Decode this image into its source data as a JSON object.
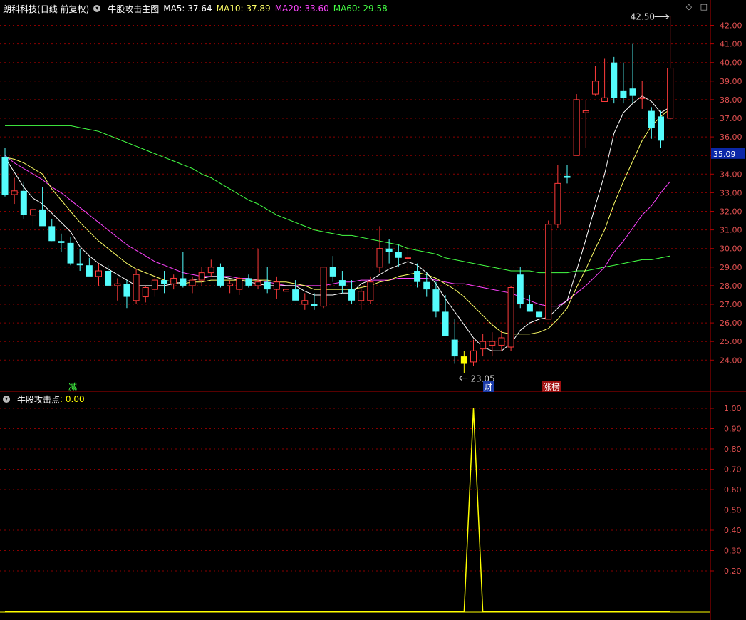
{
  "main_panel": {
    "stock_name": "朗科科技",
    "period_label": "(日线 前复权)",
    "indicator_name": "牛股攻击主图",
    "ma_legend": [
      {
        "label": "MA5: 37.64",
        "color": "#ffffff"
      },
      {
        "label": "MA10: 37.89",
        "color": "#ffff66"
      },
      {
        "label": "MA20: 33.60",
        "color": "#ff44ff"
      },
      {
        "label": "MA60: 29.58",
        "color": "#44ff44"
      }
    ]
  },
  "sub_panel": {
    "indicator_name": "牛股攻击点",
    "value_label": ": 0.00"
  },
  "markers": {
    "jian": "减",
    "cai": "财",
    "zhangbang": "涨榜",
    "high": "42.50",
    "low": "23.05",
    "current_price": "35.09"
  },
  "colors": {
    "up": "#ff3b3b",
    "down": "#54fcfc",
    "grid": "#8b0000",
    "axis": "#b00000",
    "signal": "#ffff00",
    "price_tag_bg": "#0b27a8"
  },
  "chart_data": {
    "type": "candlestick",
    "main_y_ticks": [
      24.0,
      25.0,
      26.0,
      27.0,
      28.0,
      29.0,
      30.0,
      31.0,
      32.0,
      33.0,
      34.0,
      35.0,
      36.0,
      37.0,
      38.0,
      39.0,
      40.0,
      41.0,
      42.0
    ],
    "main_y_tick_labels": [
      "24.00",
      "25.00",
      "26.00",
      "27.00",
      "28.00",
      "29.00",
      "30.00",
      "31.00",
      "32.00",
      "33.00",
      "34.00",
      "35.00",
      "36.00",
      "37.00",
      "38.00",
      "39.00",
      "40.00",
      "41.00",
      "42.00"
    ],
    "sub_y_ticks": [
      0.2,
      0.3,
      0.4,
      0.5,
      0.6,
      0.7,
      0.8,
      0.9,
      1.0
    ],
    "sub_y_tick_labels": [
      "0.20",
      "0.30",
      "0.40",
      "0.50",
      "0.60",
      "0.70",
      "0.80",
      "0.90",
      "1.00"
    ],
    "candles": [
      [
        34.9,
        35.4,
        32.8,
        32.9
      ],
      [
        32.9,
        33.8,
        32.4,
        33.1
      ],
      [
        33.1,
        33.6,
        31.6,
        31.8
      ],
      [
        31.8,
        32.2,
        31.2,
        32.1
      ],
      [
        32.1,
        33.3,
        31.3,
        31.2
      ],
      [
        31.2,
        31.6,
        30.4,
        30.4
      ],
      [
        30.4,
        30.8,
        29.8,
        30.3
      ],
      [
        30.3,
        30.6,
        29.1,
        29.2
      ],
      [
        29.2,
        30.0,
        28.8,
        29.1
      ],
      [
        29.1,
        29.5,
        28.6,
        28.5
      ],
      [
        28.5,
        29.2,
        28.0,
        28.8
      ],
      [
        28.8,
        29.1,
        28.1,
        28.0
      ],
      [
        28.0,
        28.4,
        27.2,
        28.1
      ],
      [
        28.1,
        28.3,
        26.8,
        27.4
      ],
      [
        27.2,
        28.9,
        27.0,
        28.6
      ],
      [
        27.4,
        28.0,
        27.1,
        27.9
      ],
      [
        27.8,
        28.6,
        27.4,
        28.3
      ],
      [
        28.3,
        28.8,
        27.6,
        28.1
      ],
      [
        28.1,
        28.6,
        27.8,
        28.4
      ],
      [
        28.4,
        29.8,
        27.9,
        28.0
      ],
      [
        28.0,
        28.5,
        27.6,
        28.3
      ],
      [
        28.3,
        29.0,
        28.0,
        28.7
      ],
      [
        28.7,
        29.4,
        28.5,
        29.0
      ],
      [
        29.0,
        29.2,
        27.9,
        28.0
      ],
      [
        28.0,
        28.3,
        27.6,
        28.1
      ],
      [
        27.8,
        28.5,
        27.5,
        28.4
      ],
      [
        28.4,
        28.6,
        27.9,
        28.0
      ],
      [
        28.0,
        30.0,
        27.8,
        28.2
      ],
      [
        28.2,
        29.0,
        27.6,
        27.8
      ],
      [
        27.8,
        28.5,
        27.3,
        28.2
      ],
      [
        27.7,
        28.0,
        27.1,
        27.8
      ],
      [
        27.8,
        28.3,
        27.3,
        27.2
      ],
      [
        27.0,
        27.6,
        26.7,
        27.2
      ],
      [
        27.0,
        27.6,
        26.7,
        26.9
      ],
      [
        26.9,
        29.0,
        26.8,
        29.0
      ],
      [
        29.0,
        29.6,
        28.2,
        28.5
      ],
      [
        28.3,
        28.8,
        27.6,
        28.0
      ],
      [
        27.8,
        28.3,
        27.0,
        27.2
      ],
      [
        27.2,
        27.9,
        26.7,
        27.7
      ],
      [
        27.2,
        28.5,
        27.0,
        28.2
      ],
      [
        29.0,
        31.2,
        28.7,
        30.0
      ],
      [
        30.0,
        30.5,
        29.2,
        29.8
      ],
      [
        29.8,
        30.2,
        29.0,
        29.5
      ],
      [
        29.5,
        30.2,
        28.8,
        29.5
      ],
      [
        28.8,
        29.2,
        27.9,
        28.2
      ],
      [
        28.2,
        28.7,
        27.4,
        27.8
      ],
      [
        27.8,
        28.2,
        26.3,
        26.6
      ],
      [
        26.6,
        27.5,
        25.3,
        25.3
      ],
      [
        25.1,
        26.2,
        23.8,
        24.2
      ],
      [
        24.2,
        24.5,
        23.3,
        23.8
      ],
      [
        23.9,
        25.1,
        23.7,
        24.5
      ],
      [
        24.6,
        25.4,
        24.2,
        25.0
      ],
      [
        24.8,
        25.5,
        24.2,
        25.0
      ],
      [
        24.8,
        25.6,
        24.5,
        25.2
      ],
      [
        24.7,
        28.0,
        24.5,
        27.9
      ],
      [
        28.6,
        29.0,
        26.8,
        27.0
      ],
      [
        27.0,
        27.5,
        26.6,
        26.6
      ],
      [
        26.6,
        26.9,
        26.1,
        26.3
      ],
      [
        26.2,
        31.5,
        26.2,
        31.3
      ],
      [
        31.3,
        34.5,
        31.1,
        33.5
      ],
      [
        33.9,
        34.5,
        33.5,
        33.8
      ],
      [
        35.0,
        38.3,
        35.0,
        38.0
      ],
      [
        37.3,
        38.0,
        35.4,
        37.4
      ],
      [
        38.3,
        39.8,
        38.2,
        39.0
      ],
      [
        37.9,
        40.2,
        38.0,
        38.1
      ],
      [
        40.0,
        40.3,
        37.8,
        38.1
      ],
      [
        38.5,
        40.0,
        37.8,
        38.1
      ],
      [
        38.6,
        41.0,
        37.8,
        38.2
      ],
      [
        38.1,
        39.0,
        37.5,
        38.1
      ],
      [
        37.4,
        37.6,
        35.9,
        36.5
      ],
      [
        37.1,
        37.4,
        35.4,
        35.8
      ],
      [
        37.0,
        42.5,
        36.9,
        39.7
      ]
    ],
    "special_candle_index": 49,
    "ma5": [
      34.9,
      34.1,
      33.3,
      32.7,
      32.4,
      31.9,
      31.4,
      30.9,
      30.1,
      29.6,
      29.2,
      28.9,
      28.6,
      28.3,
      28.0,
      28.0,
      28.0,
      28.0,
      28.1,
      28.2,
      28.3,
      28.4,
      28.5,
      28.5,
      28.4,
      28.3,
      28.2,
      28.1,
      28.0,
      28.0,
      28.0,
      28.0,
      27.7,
      27.5,
      27.5,
      27.5,
      27.6,
      27.6,
      28.1,
      28.3,
      28.6,
      28.9,
      29.1,
      29.3,
      29.1,
      28.7,
      28.1,
      27.3,
      26.6,
      25.9,
      25.2,
      24.7,
      24.5,
      24.5,
      24.9,
      25.6,
      26.0,
      26.2,
      26.3,
      26.8,
      27.2,
      28.8,
      30.5,
      32.3,
      34.0,
      36.2,
      37.3,
      37.8,
      38.2,
      37.9,
      37.3,
      37.6
    ],
    "ma10": [
      34.9,
      34.8,
      34.6,
      34.3,
      34.0,
      33.2,
      32.6,
      32.0,
      31.4,
      30.9,
      30.4,
      30.0,
      29.6,
      29.2,
      28.9,
      28.7,
      28.5,
      28.3,
      28.2,
      28.1,
      28.2,
      28.2,
      28.3,
      28.3,
      28.3,
      28.3,
      28.3,
      28.3,
      28.3,
      28.2,
      28.2,
      28.1,
      28.0,
      27.8,
      27.8,
      27.8,
      27.8,
      27.8,
      27.9,
      28.0,
      28.2,
      28.3,
      28.5,
      28.6,
      28.7,
      28.6,
      28.4,
      28.1,
      27.8,
      27.4,
      26.9,
      26.4,
      25.9,
      25.5,
      25.4,
      25.4,
      25.4,
      25.5,
      25.7,
      26.2,
      26.8,
      27.9,
      28.9,
      30.0,
      31.0,
      32.4,
      33.6,
      34.7,
      35.8,
      36.6,
      37.1,
      37.5
    ],
    "ma20": [
      35.0,
      34.6,
      34.3,
      34.0,
      33.7,
      33.3,
      33.0,
      32.6,
      32.2,
      31.8,
      31.4,
      31.0,
      30.6,
      30.2,
      29.9,
      29.6,
      29.3,
      29.1,
      28.9,
      28.7,
      28.6,
      28.5,
      28.5,
      28.5,
      28.5,
      28.4,
      28.4,
      28.3,
      28.2,
      28.1,
      28.0,
      28.0,
      28.0,
      28.0,
      28.0,
      28.1,
      28.2,
      28.2,
      28.3,
      28.3,
      28.3,
      28.3,
      28.4,
      28.4,
      28.4,
      28.4,
      28.3,
      28.2,
      28.1,
      28.1,
      28.0,
      27.9,
      27.8,
      27.7,
      27.6,
      27.4,
      27.2,
      27.0,
      26.9,
      26.9,
      27.2,
      27.6,
      28.0,
      28.5,
      29.0,
      29.8,
      30.4,
      31.1,
      31.8,
      32.3,
      33.0,
      33.6
    ],
    "ma60": [
      36.6,
      36.6,
      36.6,
      36.6,
      36.6,
      36.6,
      36.6,
      36.6,
      36.5,
      36.4,
      36.3,
      36.1,
      35.9,
      35.7,
      35.5,
      35.3,
      35.1,
      34.9,
      34.7,
      34.5,
      34.3,
      34.0,
      33.8,
      33.5,
      33.2,
      32.9,
      32.6,
      32.4,
      32.1,
      31.8,
      31.6,
      31.4,
      31.2,
      31.0,
      30.9,
      30.8,
      30.7,
      30.7,
      30.6,
      30.5,
      30.4,
      30.3,
      30.2,
      30.0,
      29.9,
      29.8,
      29.7,
      29.5,
      29.4,
      29.3,
      29.2,
      29.1,
      29.0,
      28.9,
      28.8,
      28.8,
      28.8,
      28.7,
      28.7,
      28.7,
      28.7,
      28.8,
      28.8,
      28.9,
      29.0,
      29.1,
      29.2,
      29.3,
      29.4,
      29.4,
      29.5,
      29.6
    ],
    "signal": [
      0,
      0,
      0,
      0,
      0,
      0,
      0,
      0,
      0,
      0,
      0,
      0,
      0,
      0,
      0,
      0,
      0,
      0,
      0,
      0,
      0,
      0,
      0,
      0,
      0,
      0,
      0,
      0,
      0,
      0,
      0,
      0,
      0,
      0,
      0,
      0,
      0,
      0,
      0,
      0,
      0,
      0,
      0,
      0,
      0,
      0,
      0,
      0,
      0,
      0,
      1,
      0,
      0,
      0,
      0,
      0,
      0,
      0,
      0,
      0,
      0,
      0,
      0,
      0,
      0,
      0,
      0,
      0,
      0,
      0,
      0,
      0
    ]
  }
}
